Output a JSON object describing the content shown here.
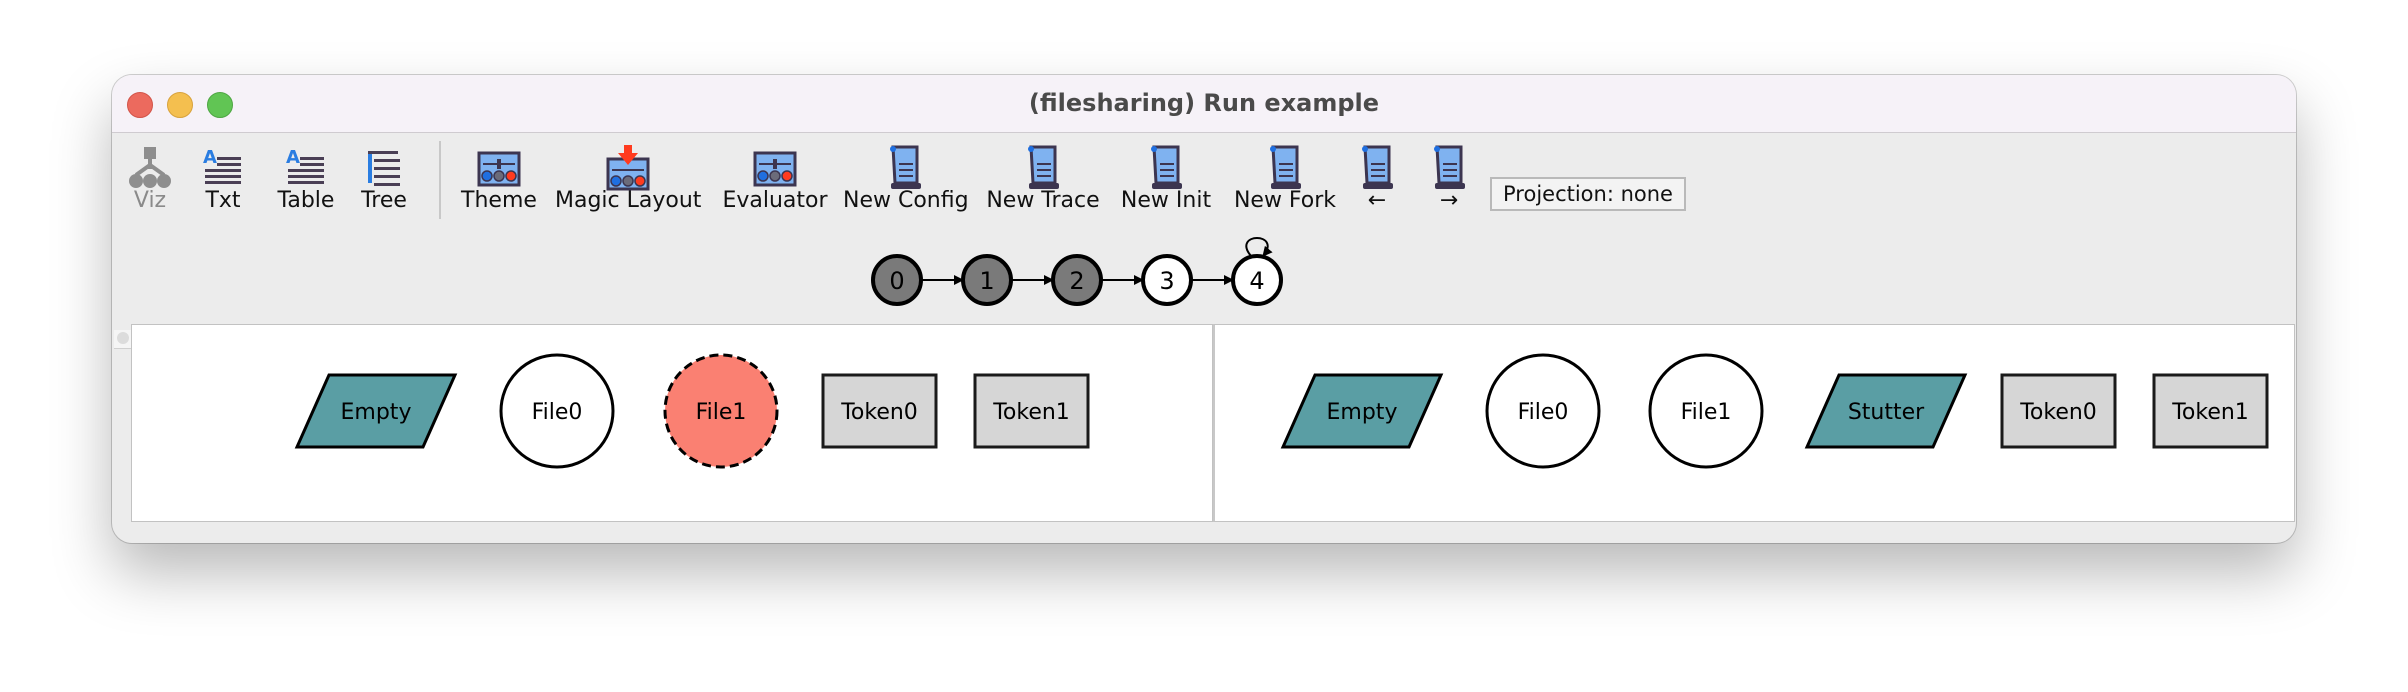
{
  "window": {
    "title": "(filesharing) Run example",
    "traffic_lights": [
      "close",
      "minimize",
      "maximize"
    ]
  },
  "toolbar": {
    "buttons": [
      {
        "id": "viz",
        "label": "Viz",
        "icon": "graph-tree-icon",
        "enabled": false
      },
      {
        "id": "txt",
        "label": "Txt",
        "icon": "text-lines-icon",
        "enabled": true
      },
      {
        "id": "table",
        "label": "Table",
        "icon": "table-lines-icon",
        "enabled": true
      },
      {
        "id": "tree",
        "label": "Tree",
        "icon": "tree-list-icon",
        "enabled": true
      },
      {
        "id": "theme",
        "label": "Theme",
        "icon": "theme-panel-icon",
        "enabled": true
      },
      {
        "id": "magic-layout",
        "label": "Magic Layout",
        "icon": "magic-layout-icon",
        "enabled": true
      },
      {
        "id": "evaluator",
        "label": "Evaluator",
        "icon": "evaluator-panel-icon",
        "enabled": true
      },
      {
        "id": "new-config",
        "label": "New Config",
        "icon": "scroll-icon",
        "enabled": true
      },
      {
        "id": "new-trace",
        "label": "New Trace",
        "icon": "scroll-icon",
        "enabled": true
      },
      {
        "id": "new-init",
        "label": "New Init",
        "icon": "scroll-icon",
        "enabled": true
      },
      {
        "id": "new-fork",
        "label": "New Fork",
        "icon": "scroll-icon",
        "enabled": true
      },
      {
        "id": "prev",
        "label": "←",
        "icon": "scroll-icon",
        "enabled": true
      },
      {
        "id": "next",
        "label": "→",
        "icon": "scroll-icon",
        "enabled": true
      }
    ],
    "projection_label": "Projection: none"
  },
  "trace": {
    "states": [
      {
        "label": "0",
        "visited": true
      },
      {
        "label": "1",
        "visited": true
      },
      {
        "label": "2",
        "visited": true
      },
      {
        "label": "3",
        "visited": false
      },
      {
        "label": "4",
        "visited": false,
        "self_loop": true
      }
    ],
    "colors": {
      "visited": "#7a7a7a",
      "unvisited": "#ffffff"
    }
  },
  "panels": [
    {
      "id": "left",
      "nodes": [
        {
          "label": "Empty",
          "shape": "parallelogram",
          "fill": "#5a9ea4"
        },
        {
          "label": "File0",
          "shape": "circle",
          "fill": "#ffffff"
        },
        {
          "label": "File1",
          "shape": "circle",
          "fill": "#fa8072",
          "dashed": true
        },
        {
          "label": "Token0",
          "shape": "rect",
          "fill": "#d6d6d6"
        },
        {
          "label": "Token1",
          "shape": "rect",
          "fill": "#d6d6d6"
        }
      ]
    },
    {
      "id": "right",
      "nodes": [
        {
          "label": "Empty",
          "shape": "parallelogram",
          "fill": "#5a9ea4"
        },
        {
          "label": "File0",
          "shape": "circle",
          "fill": "#ffffff"
        },
        {
          "label": "File1",
          "shape": "circle",
          "fill": "#ffffff"
        },
        {
          "label": "Stutter",
          "shape": "parallelogram",
          "fill": "#5a9ea4"
        },
        {
          "label": "Token0",
          "shape": "rect",
          "fill": "#d6d6d6"
        },
        {
          "label": "Token1",
          "shape": "rect",
          "fill": "#d6d6d6"
        }
      ]
    }
  ]
}
